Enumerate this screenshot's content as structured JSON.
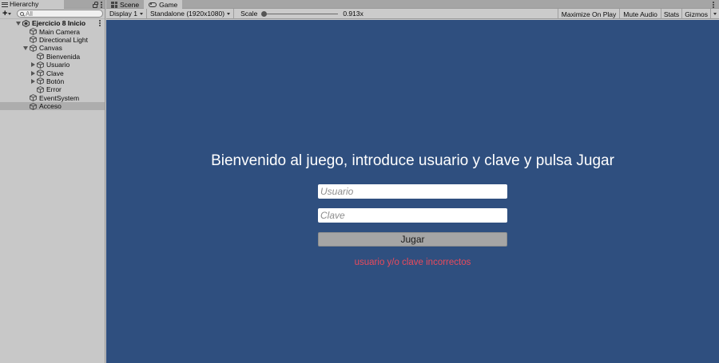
{
  "hierarchy": {
    "tab_label": "Hierarchy",
    "search_placeholder": "All",
    "scene_name": "Ejercicio 8 Inicio",
    "items": [
      {
        "label": "Main Camera"
      },
      {
        "label": "Directional Light"
      },
      {
        "label": "Canvas"
      },
      {
        "label": "Bienvenida"
      },
      {
        "label": "Usuario"
      },
      {
        "label": "Clave"
      },
      {
        "label": "Botón"
      },
      {
        "label": "Error"
      },
      {
        "label": "EventSystem"
      },
      {
        "label": "Acceso"
      }
    ],
    "selected_item": "Acceso"
  },
  "tabs": [
    {
      "label": "Scene",
      "icon": "grid-icon"
    },
    {
      "label": "Game",
      "icon": "gamepad-icon",
      "active": true
    }
  ],
  "toolbar": {
    "display": "Display 1",
    "resolution": "Standalone (1920x1080)",
    "scale_label": "Scale",
    "scale_value": "0.913x",
    "maximize": "Maximize On Play",
    "mute": "Mute Audio",
    "stats": "Stats",
    "gizmos": "Gizmos"
  },
  "game": {
    "background_color": "#2f4f7f",
    "welcome_text": "Bienvenido al juego, introduce usuario y clave y pulsa Jugar",
    "user_placeholder": "Usuario",
    "password_placeholder": "Clave",
    "play_button": "Jugar",
    "error_text": "usuario y/o clave incorrectos",
    "error_color": "#e94a5c"
  }
}
